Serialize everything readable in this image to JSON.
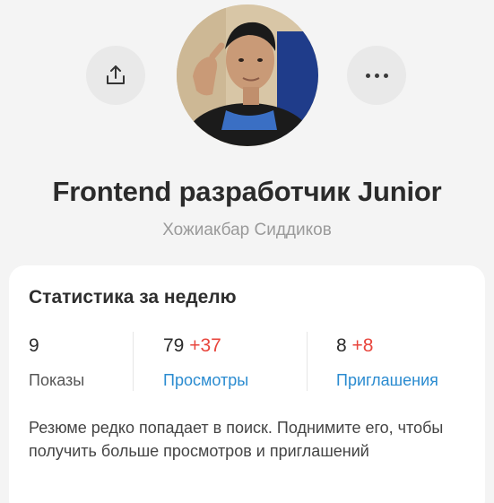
{
  "header": {
    "share_icon": "share-icon",
    "more_icon": "more-horizontal-icon"
  },
  "profile": {
    "title": "Frontend разработчик Junior",
    "name": "Хожиакбар Сиддиков"
  },
  "stats_card": {
    "title": "Статистика за неделю",
    "items": [
      {
        "value": "9",
        "delta": "",
        "label": "Показы"
      },
      {
        "value": "79",
        "delta": "+37",
        "label": "Просмотры"
      },
      {
        "value": "8",
        "delta": "+8",
        "label": "Приглашения"
      }
    ],
    "note": "Резюме редко попадает в поиск. Поднимите его, чтобы получить больше просмотров и приглашений"
  },
  "colors": {
    "background": "#f4f4f4",
    "card": "#ffffff",
    "link": "#2a8bd0",
    "delta": "#e8453c"
  }
}
